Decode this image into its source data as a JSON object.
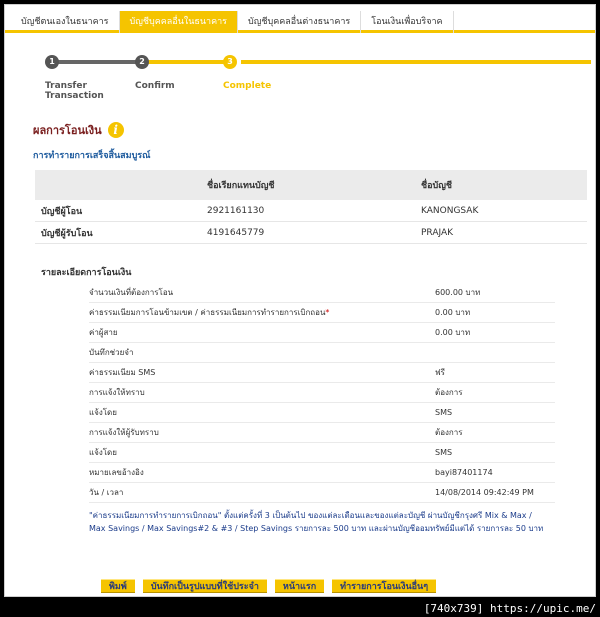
{
  "tabs": [
    {
      "label": "บัญชีตนเองในธนาคาร",
      "active": false
    },
    {
      "label": "บัญชีบุคคลอื่นในธนาคาร",
      "active": true
    },
    {
      "label": "บัญชีบุคคลอื่นต่างธนาคาร",
      "active": false
    },
    {
      "label": "โอนเงินเพื่อบริจาค",
      "active": false
    }
  ],
  "steps": [
    {
      "number": "1",
      "label": "Transfer Transaction"
    },
    {
      "number": "2",
      "label": "Confirm"
    },
    {
      "number": "3",
      "label": "Complete"
    }
  ],
  "result": {
    "title": "ผลการโอนเงิน",
    "status": "การทำรายการเสร็จสิ้นสมบูรณ์"
  },
  "accounts": {
    "headers": [
      "",
      "ชื่อเรียกแทนบัญชี",
      "ชื่อบัญชี"
    ],
    "rows": [
      {
        "type": "บัญชีผู้โอน",
        "number": "2921161130",
        "name": "KANONGSAK"
      },
      {
        "type": "บัญชีผู้รับโอน",
        "number": "4191645779",
        "name": "PRAJAK"
      }
    ]
  },
  "details": {
    "title": "รายละเอียดการโอนเงิน",
    "rows": [
      {
        "label": "จำนวนเงินที่ต้องการโอน",
        "value": "600.00 บาท"
      },
      {
        "label": "ค่าธรรมเนียมการโอนข้ามเขต / ค่าธรรมเนียมการทำรายการเบิกถอน",
        "req": "*",
        "value": "0.00 บาท"
      },
      {
        "label": "ค่าผู้สาย",
        "value": "0.00 บาท"
      },
      {
        "label": "บันทึกช่วยจำ",
        "value": ""
      },
      {
        "label": "ค่าธรรมเนียม SMS",
        "value": "ฟรี"
      },
      {
        "label": "การแจ้งให้ทราบ",
        "value": "ต้องการ"
      },
      {
        "label": "แจ้งโดย",
        "value": "SMS"
      },
      {
        "label": "การแจ้งให้ผู้รับทราบ",
        "value": "ต้องการ"
      },
      {
        "label": "แจ้งโดย",
        "value": "SMS"
      },
      {
        "label": "หมายเลขอ้างอิง",
        "value": "bayi87401174"
      },
      {
        "label": "วัน / เวลา",
        "value": "14/08/2014 09:42:49 PM"
      }
    ]
  },
  "note": "\"ค่าธรรมเนียมการทำรายการเบิกถอน\" ตั้งแต่ครั้งที่ 3 เป็นต้นไป ของแต่ละเดือนและของแต่ละบัญชี ผ่านบัญชีกรุงศรี Mix & Max / Max Savings / Max Savings#2 & #3 / Step Savings รายการละ 500 บาท และผ่านบัญชีออมทรัพย์มีแต่ได้ รายการละ 50 บาท",
  "buttons": {
    "print": "พิมพ์",
    "save_template": "บันทึกเป็นรูปแบบที่ใช้ประจำ",
    "home": "หน้าแรก",
    "new_transfer": "ทำรายการโอนเงินอื่นๆ"
  },
  "watermark": "[740x739] https://upic.me/",
  "colors": {
    "accent": "#f5c400",
    "title": "#7a1f1f",
    "link": "#1e5b9e"
  }
}
